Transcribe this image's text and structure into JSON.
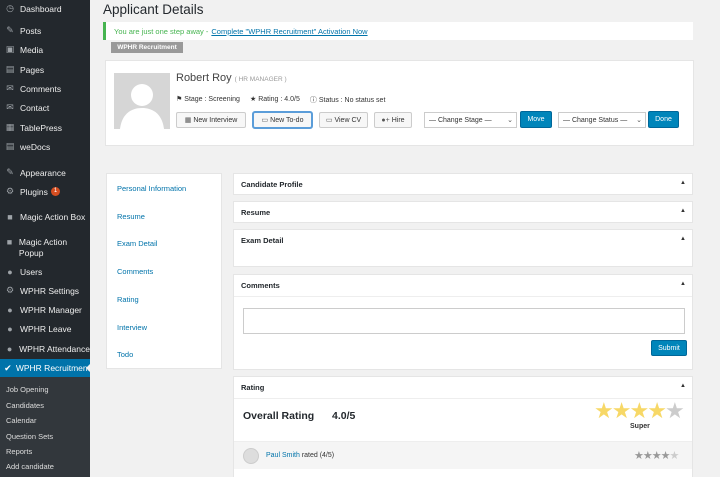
{
  "sidebar": {
    "items": [
      {
        "icon": "dashboard-icon",
        "glyph": "◷",
        "label": "Dashboard"
      },
      {
        "icon": "pin-icon",
        "glyph": "✎",
        "label": "Posts"
      },
      {
        "icon": "media-icon",
        "glyph": "▣",
        "label": "Media"
      },
      {
        "icon": "pages-icon",
        "glyph": "▤",
        "label": "Pages"
      },
      {
        "icon": "comments-icon",
        "glyph": "✉",
        "label": "Comments"
      },
      {
        "icon": "contact-icon",
        "glyph": "✉",
        "label": "Contact"
      },
      {
        "icon": "table-icon",
        "glyph": "▦",
        "label": "TablePress"
      },
      {
        "icon": "docs-icon",
        "glyph": "▤",
        "label": "weDocs"
      },
      {
        "icon": "appearance-icon",
        "glyph": "✎",
        "label": "Appearance"
      },
      {
        "icon": "plugins-icon",
        "glyph": "⚙",
        "label": "Plugins",
        "badge": "1"
      },
      {
        "icon": "magic-box-icon",
        "glyph": "■",
        "label": "Magic Action Box"
      },
      {
        "icon": "magic-popup-icon",
        "glyph": "■",
        "label": "Magic Action Popup"
      },
      {
        "icon": "users-icon",
        "glyph": "●",
        "label": "Users"
      },
      {
        "icon": "settings-icon",
        "glyph": "⚙",
        "label": "WPHR Settings"
      },
      {
        "icon": "manager-icon",
        "glyph": "●",
        "label": "WPHR Manager"
      },
      {
        "icon": "leave-icon",
        "glyph": "●",
        "label": "WPHR Leave"
      },
      {
        "icon": "attendance-icon",
        "glyph": "●",
        "label": "WPHR Attendance"
      },
      {
        "icon": "recruitment-icon",
        "glyph": "✔",
        "label": "WPHR Recruitment"
      }
    ],
    "submenu": [
      "Job Opening",
      "Candidates",
      "Calendar",
      "Question Sets",
      "Reports",
      "Add candidate"
    ]
  },
  "page": {
    "title": "Applicant Details",
    "notice_text": "You are just one step away -",
    "notice_link": "Complete \"WPHR Recruitment\" Activation Now",
    "plugin_tag": "WPHR Recruitment"
  },
  "applicant": {
    "name": "Robert Roy",
    "role": "( HR MANAGER )",
    "stage": "Stage : Screening",
    "rating": "Rating : 4.0/5",
    "status": "Status : No status set",
    "buttons": {
      "new_interview": "New Interview",
      "new_todo": "New To-do",
      "view_cv": "View CV",
      "hire": "Hire",
      "move": "Move",
      "done": "Done"
    },
    "change_stage": "— Change Stage —",
    "change_status": "— Change Status —"
  },
  "left_nav": [
    "Personal Information",
    "Resume",
    "Exam Detail",
    "Comments",
    "Rating",
    "Interview",
    "Todo"
  ],
  "panels": {
    "candidate_profile": "Candidate Profile",
    "resume": "Resume",
    "exam_detail": "Exam Detail",
    "comments": "Comments",
    "submit": "Submit",
    "rating": "Rating",
    "toggle_glyph": "▲"
  },
  "rating": {
    "overall_label": "Overall Rating",
    "overall_value": "4.0/5",
    "stars_filled": 4,
    "stars_total": 5,
    "descriptor": "Super",
    "entries": [
      {
        "user": "Paul Smith",
        "text": "rated (4/5)",
        "stars": 4
      }
    ]
  },
  "colors": {
    "accent": "#0073aa",
    "notice": "#46b450",
    "sidebar": "#23282d",
    "star": "#f7d867"
  }
}
